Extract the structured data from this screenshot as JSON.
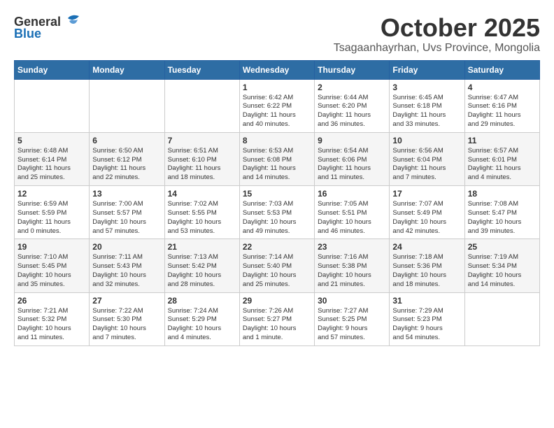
{
  "header": {
    "logo_general": "General",
    "logo_blue": "Blue",
    "month_year": "October 2025",
    "location": "Tsagaanhayrhan, Uvs Province, Mongolia"
  },
  "days_of_week": [
    "Sunday",
    "Monday",
    "Tuesday",
    "Wednesday",
    "Thursday",
    "Friday",
    "Saturday"
  ],
  "weeks": [
    [
      {
        "day": "",
        "content": ""
      },
      {
        "day": "",
        "content": ""
      },
      {
        "day": "",
        "content": ""
      },
      {
        "day": "1",
        "content": "Sunrise: 6:42 AM\nSunset: 6:22 PM\nDaylight: 11 hours\nand 40 minutes."
      },
      {
        "day": "2",
        "content": "Sunrise: 6:44 AM\nSunset: 6:20 PM\nDaylight: 11 hours\nand 36 minutes."
      },
      {
        "day": "3",
        "content": "Sunrise: 6:45 AM\nSunset: 6:18 PM\nDaylight: 11 hours\nand 33 minutes."
      },
      {
        "day": "4",
        "content": "Sunrise: 6:47 AM\nSunset: 6:16 PM\nDaylight: 11 hours\nand 29 minutes."
      }
    ],
    [
      {
        "day": "5",
        "content": "Sunrise: 6:48 AM\nSunset: 6:14 PM\nDaylight: 11 hours\nand 25 minutes."
      },
      {
        "day": "6",
        "content": "Sunrise: 6:50 AM\nSunset: 6:12 PM\nDaylight: 11 hours\nand 22 minutes."
      },
      {
        "day": "7",
        "content": "Sunrise: 6:51 AM\nSunset: 6:10 PM\nDaylight: 11 hours\nand 18 minutes."
      },
      {
        "day": "8",
        "content": "Sunrise: 6:53 AM\nSunset: 6:08 PM\nDaylight: 11 hours\nand 14 minutes."
      },
      {
        "day": "9",
        "content": "Sunrise: 6:54 AM\nSunset: 6:06 PM\nDaylight: 11 hours\nand 11 minutes."
      },
      {
        "day": "10",
        "content": "Sunrise: 6:56 AM\nSunset: 6:04 PM\nDaylight: 11 hours\nand 7 minutes."
      },
      {
        "day": "11",
        "content": "Sunrise: 6:57 AM\nSunset: 6:01 PM\nDaylight: 11 hours\nand 4 minutes."
      }
    ],
    [
      {
        "day": "12",
        "content": "Sunrise: 6:59 AM\nSunset: 5:59 PM\nDaylight: 11 hours\nand 0 minutes."
      },
      {
        "day": "13",
        "content": "Sunrise: 7:00 AM\nSunset: 5:57 PM\nDaylight: 10 hours\nand 57 minutes."
      },
      {
        "day": "14",
        "content": "Sunrise: 7:02 AM\nSunset: 5:55 PM\nDaylight: 10 hours\nand 53 minutes."
      },
      {
        "day": "15",
        "content": "Sunrise: 7:03 AM\nSunset: 5:53 PM\nDaylight: 10 hours\nand 49 minutes."
      },
      {
        "day": "16",
        "content": "Sunrise: 7:05 AM\nSunset: 5:51 PM\nDaylight: 10 hours\nand 46 minutes."
      },
      {
        "day": "17",
        "content": "Sunrise: 7:07 AM\nSunset: 5:49 PM\nDaylight: 10 hours\nand 42 minutes."
      },
      {
        "day": "18",
        "content": "Sunrise: 7:08 AM\nSunset: 5:47 PM\nDaylight: 10 hours\nand 39 minutes."
      }
    ],
    [
      {
        "day": "19",
        "content": "Sunrise: 7:10 AM\nSunset: 5:45 PM\nDaylight: 10 hours\nand 35 minutes."
      },
      {
        "day": "20",
        "content": "Sunrise: 7:11 AM\nSunset: 5:43 PM\nDaylight: 10 hours\nand 32 minutes."
      },
      {
        "day": "21",
        "content": "Sunrise: 7:13 AM\nSunset: 5:42 PM\nDaylight: 10 hours\nand 28 minutes."
      },
      {
        "day": "22",
        "content": "Sunrise: 7:14 AM\nSunset: 5:40 PM\nDaylight: 10 hours\nand 25 minutes."
      },
      {
        "day": "23",
        "content": "Sunrise: 7:16 AM\nSunset: 5:38 PM\nDaylight: 10 hours\nand 21 minutes."
      },
      {
        "day": "24",
        "content": "Sunrise: 7:18 AM\nSunset: 5:36 PM\nDaylight: 10 hours\nand 18 minutes."
      },
      {
        "day": "25",
        "content": "Sunrise: 7:19 AM\nSunset: 5:34 PM\nDaylight: 10 hours\nand 14 minutes."
      }
    ],
    [
      {
        "day": "26",
        "content": "Sunrise: 7:21 AM\nSunset: 5:32 PM\nDaylight: 10 hours\nand 11 minutes."
      },
      {
        "day": "27",
        "content": "Sunrise: 7:22 AM\nSunset: 5:30 PM\nDaylight: 10 hours\nand 7 minutes."
      },
      {
        "day": "28",
        "content": "Sunrise: 7:24 AM\nSunset: 5:29 PM\nDaylight: 10 hours\nand 4 minutes."
      },
      {
        "day": "29",
        "content": "Sunrise: 7:26 AM\nSunset: 5:27 PM\nDaylight: 10 hours\nand 1 minute."
      },
      {
        "day": "30",
        "content": "Sunrise: 7:27 AM\nSunset: 5:25 PM\nDaylight: 9 hours\nand 57 minutes."
      },
      {
        "day": "31",
        "content": "Sunrise: 7:29 AM\nSunset: 5:23 PM\nDaylight: 9 hours\nand 54 minutes."
      },
      {
        "day": "",
        "content": ""
      }
    ]
  ]
}
